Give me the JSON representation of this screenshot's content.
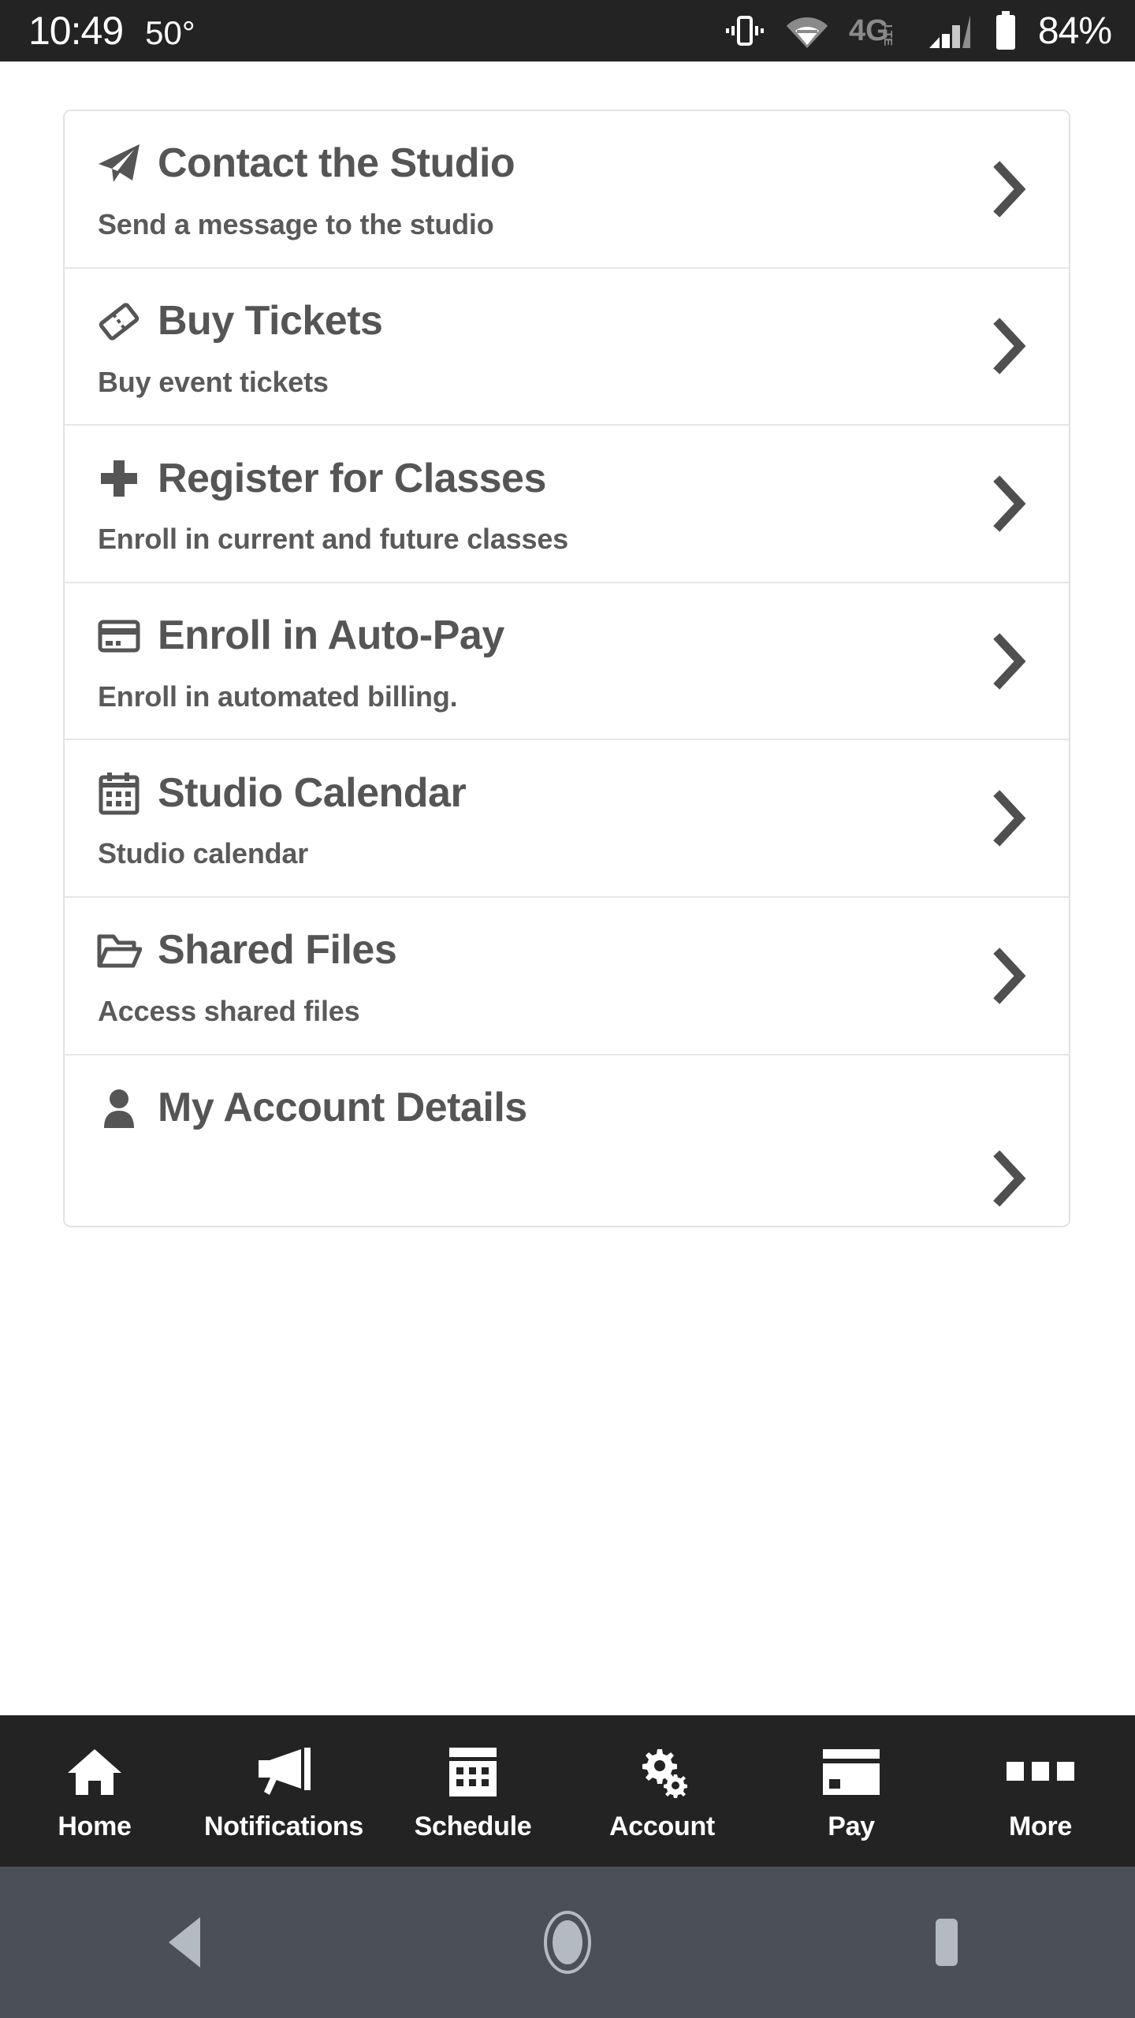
{
  "status_bar": {
    "time": "10:49",
    "temperature": "50°",
    "network_label": "4G LTE",
    "battery_percent": "84%",
    "icons": [
      "vibrate-icon",
      "wifi-icon",
      "network-4glte-icon",
      "signal-bars-icon",
      "battery-icon"
    ],
    "background_color": "#232323",
    "text_color": "#ffffff"
  },
  "list": {
    "items": [
      {
        "icon": "paper-plane-icon",
        "title": "Contact the Studio",
        "subtitle": "Send a message to the studio",
        "chevron": "chevron-right-icon"
      },
      {
        "icon": "ticket-icon",
        "title": "Buy Tickets",
        "subtitle": "Buy event tickets",
        "chevron": "chevron-right-icon"
      },
      {
        "icon": "plus-icon",
        "title": "Register for Classes",
        "subtitle": "Enroll in current and future classes",
        "chevron": "chevron-right-icon"
      },
      {
        "icon": "credit-card-icon",
        "title": "Enroll in Auto-Pay",
        "subtitle": "Enroll in automated billing.",
        "chevron": "chevron-right-icon"
      },
      {
        "icon": "calendar-icon",
        "title": "Studio Calendar",
        "subtitle": "Studio calendar",
        "chevron": "chevron-right-icon"
      },
      {
        "icon": "folder-open-icon",
        "title": "Shared Files",
        "subtitle": "Access shared files",
        "chevron": "chevron-right-icon"
      },
      {
        "icon": "user-icon",
        "title": "My Account Details",
        "subtitle": "",
        "chevron": "chevron-right-icon"
      }
    ],
    "title_color": "#555555",
    "subtitle_color": "#5a5a5a",
    "divider_color": "#e6e6e6",
    "card_background": "#ffffff"
  },
  "tab_bar": {
    "background_color": "#232323",
    "label_color": "#ffffff",
    "tabs": [
      {
        "label": "Home",
        "icon": "home-icon"
      },
      {
        "label": "Notifications",
        "icon": "megaphone-icon"
      },
      {
        "label": "Schedule",
        "icon": "calendar-grid-icon"
      },
      {
        "label": "Account",
        "icon": "gears-icon"
      },
      {
        "label": "Pay",
        "icon": "credit-card-icon"
      },
      {
        "label": "More",
        "icon": "three-squares-icon"
      }
    ]
  },
  "android_nav": {
    "background_color": "#4a5055",
    "buttons": [
      {
        "name": "back-button",
        "icon": "triangle-left-icon"
      },
      {
        "name": "home-button",
        "icon": "circle-icon"
      },
      {
        "name": "recents-button",
        "icon": "square-icon"
      }
    ]
  }
}
